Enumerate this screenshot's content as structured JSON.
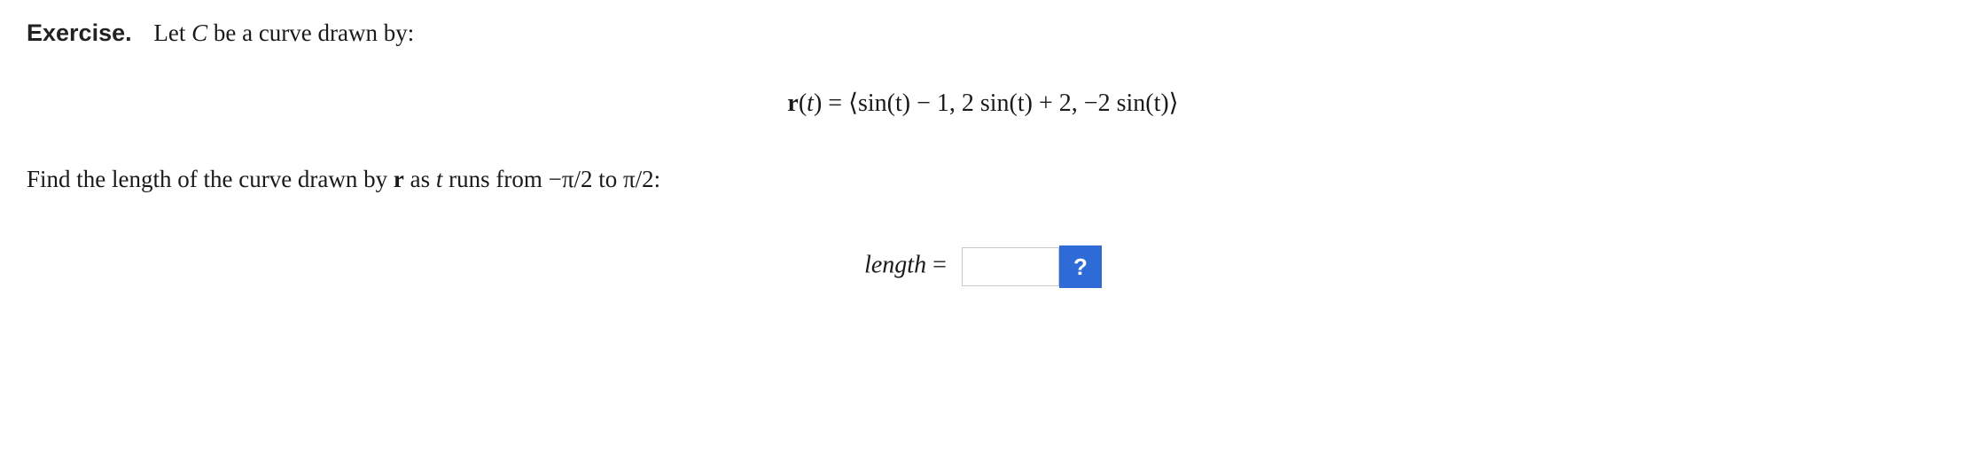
{
  "exercise": {
    "label": "Exercise.",
    "intro_prefix": "Let ",
    "intro_curve_var": "C",
    "intro_suffix": " be a curve drawn by:"
  },
  "equation": {
    "lhs_r": "r",
    "lhs_arg_open": "(",
    "lhs_arg_var": "t",
    "lhs_arg_close": ")",
    "eq": " = ",
    "rhs": "⟨sin(t) − 1, 2 sin(t) + 2, −2 sin(t)⟩"
  },
  "prompt": {
    "p1": "Find the length of the curve drawn by ",
    "r_bold": "r",
    "p2": " as ",
    "t_var": "t",
    "p3": " runs from −π/2 to π/2:"
  },
  "answer": {
    "label": "length",
    "eq": " = ",
    "value": "",
    "hint_label": "?"
  }
}
